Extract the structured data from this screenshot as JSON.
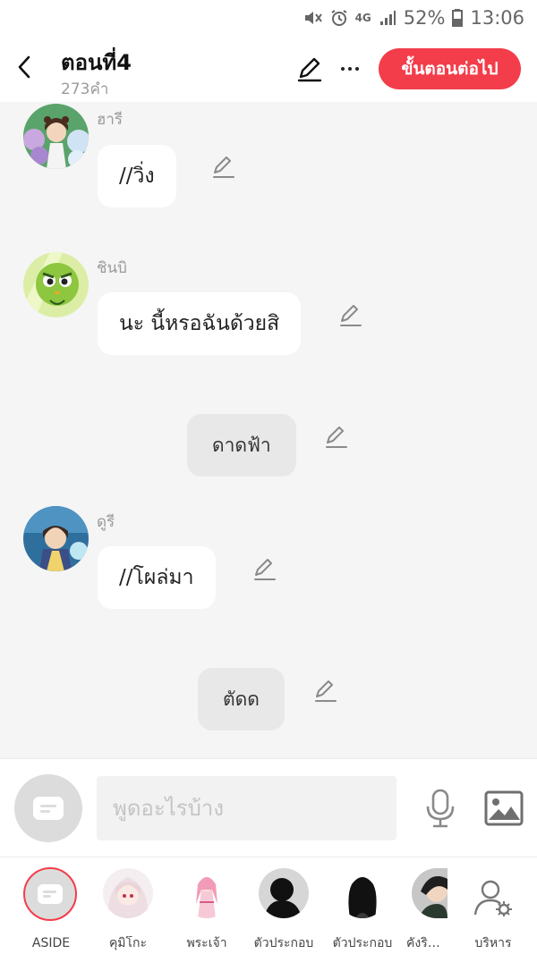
{
  "status_bar": {
    "network": "4G",
    "battery": "52%",
    "time": "13:06"
  },
  "header": {
    "title": "ตอนที่4",
    "word_count": "273คำ",
    "next_button": "ขั้นตอนต่อไป"
  },
  "messages": [
    {
      "sender": "ฮารี",
      "text": "//วิ่ง",
      "avatar": "hari-avatar"
    },
    {
      "sender": "ชินบิ",
      "text": "นะ นี้หรอฉันด้วยสิ",
      "avatar": "shinbi-avatar"
    },
    {
      "text": "ดาดฟ้า",
      "narration": true
    },
    {
      "sender": "ดูรี",
      "text": "//โผล่มา",
      "avatar": "duri-avatar"
    },
    {
      "text": "ตัดด",
      "narration": true
    }
  ],
  "composer": {
    "placeholder": "พูดอะไรบ้าง",
    "value": ""
  },
  "characters": [
    {
      "label": "ASIDE",
      "icon": "aside-icon"
    },
    {
      "label": "คุมิโกะ"
    },
    {
      "label": "พระเจ้า"
    },
    {
      "label": "ตัวประกอบ"
    },
    {
      "label": "ตัวประกอบ"
    },
    {
      "label": "คังริม(ท"
    },
    {
      "label": "บริหาร",
      "icon": "user-settings-icon"
    }
  ],
  "colors": {
    "accent": "#f33d4a",
    "background": "#f5f5f5",
    "bubble": "#ffffff",
    "narration_bubble": "#e8e8e8"
  }
}
